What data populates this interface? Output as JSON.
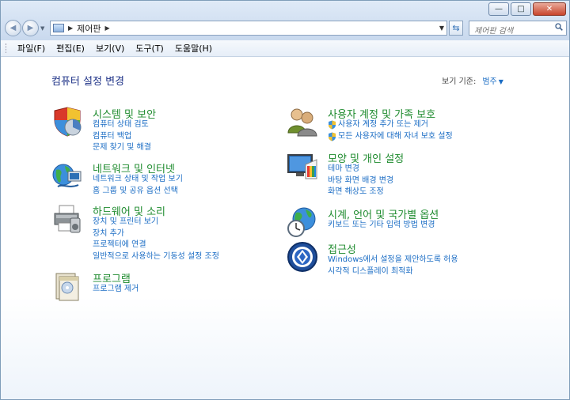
{
  "window": {
    "caption_minimize": "—",
    "caption_maximize": "□",
    "caption_close": "✕"
  },
  "nav": {
    "address_crumbs": [
      "제어판"
    ],
    "search_placeholder": "제어판 검색"
  },
  "menu": [
    "파일(F)",
    "편집(E)",
    "보기(V)",
    "도구(T)",
    "도움말(H)"
  ],
  "main": {
    "title": "컴퓨터 설정 변경",
    "view_by_label": "보기 기준:",
    "view_by_value": "범주"
  },
  "categories_left": [
    {
      "title": "시스템 및 보안",
      "links": [
        "컴퓨터 상태 검토",
        "컴퓨터 백업",
        "문제 찾기 및 해결"
      ]
    },
    {
      "title": "네트워크 및 인터넷",
      "links": [
        "네트워크 상태 및 작업 보기",
        "홈 그룹 및 공유 옵션 선택"
      ]
    },
    {
      "title": "하드웨어 및 소리",
      "links": [
        "장치 및 프린터 보기",
        "장치 추가",
        "프로젝터에 연결",
        "일반적으로 사용하는 기동성 설정 조정"
      ]
    },
    {
      "title": "프로그램",
      "links": [
        "프로그램 제거"
      ]
    }
  ],
  "categories_right": [
    {
      "title": "사용자 계정 및 가족 보호",
      "links": [
        "사용자 계정 추가 또는 제거",
        "모든 사용자에 대해 자녀 보호 설정"
      ]
    },
    {
      "title": "모양 및 개인 설정",
      "links": [
        "테마 변경",
        "바탕 화면 배경 변경",
        "화면 해상도 조정"
      ]
    },
    {
      "title": "시계, 언어 및 국가별 옵션",
      "links": [
        "키보드 또는 기타 입력 방법 변경"
      ]
    },
    {
      "title": "접근성",
      "links": [
        "Windows에서 설정을 제안하도록 허용",
        "시각적 디스플레이 최적화"
      ]
    }
  ],
  "colors": {
    "category_title": "#1e8b2e",
    "link": "#1a6cc4",
    "page_title": "#1e3287"
  }
}
